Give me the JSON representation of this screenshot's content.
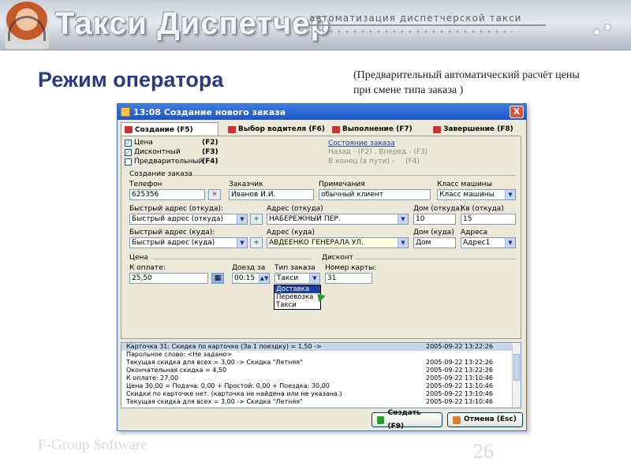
{
  "header": {
    "app_name": "Такси Диспетчер",
    "tagline": "автоматизация диспетчерской такси"
  },
  "slide": {
    "title": "Режим оператора",
    "subtitle": "(Предварительный автоматический расчёт цены при смене типа заказа )",
    "footer_brand": "F-Group Software",
    "page_number": "26"
  },
  "window": {
    "title": "13:08 Создание нового заказа",
    "close_label": "X",
    "tabs": [
      {
        "label": "Создание (F5)"
      },
      {
        "label": "Выбор водителя (F6)"
      },
      {
        "label": "Выполнение (F7)"
      },
      {
        "label": "Завершение (F8)"
      }
    ],
    "options": [
      {
        "label": "Цена",
        "hotkey": "(F2)",
        "checked": true
      },
      {
        "label": "Дисконтный",
        "hotkey": "(F3)",
        "checked": true
      },
      {
        "label": "Предварительный",
        "hotkey": "(F4)",
        "checked": false
      }
    ],
    "status": {
      "link": "Состояние заказа",
      "back": "Назад - (F2) . Вперед - (F3)",
      "end": "В конец (в пути) -",
      "end_key": "(F4)"
    },
    "section_order": "Создание заказа",
    "phone": {
      "label": "Телефон",
      "value": "625356"
    },
    "customer": {
      "label": "Заказчик",
      "value": "Иванов И.И."
    },
    "notes": {
      "label": "Примечания",
      "value": "обычный клиент"
    },
    "car_class": {
      "label": "Класс машины",
      "value": "Класс машины"
    },
    "quick_from": {
      "label": "Быстрый адрес (откуда):",
      "value": "Быстрый адрес (откуда)"
    },
    "addr_from": {
      "label": "Адрес (откуда)",
      "value": "НАБЕРЕЖНЫЙ ПЕР."
    },
    "house_from": {
      "label": "Дом (откуда)",
      "value": "10"
    },
    "apt_from": {
      "label": "Кв (откуда)",
      "value": "15"
    },
    "quick_to": {
      "label": "Быстрый адрес (куда):",
      "value": "Быстрый адрес (куда)"
    },
    "addr_to": {
      "label": "Адрес (куда)",
      "value": "АВДЕЕНКО ГЕНЕРАЛА УЛ."
    },
    "house_to": {
      "label": "Дом (куда)",
      "value": "Дом"
    },
    "address_sel": {
      "label": "Адреса",
      "value": "Адрес1"
    },
    "section_price": "Цена",
    "section_discount": "Дисконт",
    "to_pay": {
      "label": "К оплате:",
      "value": "25,50"
    },
    "arrival": {
      "label": "Доезд за",
      "value": "00:15"
    },
    "order_type": {
      "label": "Тип заказа",
      "value": "Такси"
    },
    "card": {
      "label": "Номер карты:",
      "value": "31"
    },
    "dropdown_options": [
      "Доставка",
      "Перевозка",
      "Такси"
    ],
    "log": [
      {
        "msg": "Карточка 31: Скидка по карточке (За 1 поездку) = 1,50 ->",
        "ts": "2005-09-22 13:22:26"
      },
      {
        "msg": "Парольное слово: <Не задано>",
        "ts": ""
      },
      {
        "msg": "Текущая скидка для всех = 3,00 -> Скидка \"Летняя\"",
        "ts": "2005-09-22 13:22:26"
      },
      {
        "msg": "Окончательная скидка = 4,50",
        "ts": "2005-09-22 13:22:26"
      },
      {
        "msg": "К оплате: 27,00",
        "ts": "2005-09-22 13:10:46"
      },
      {
        "msg": "Цена 30,00 = Подача: 0,00 + Простой: 0,00 + Поездка: 30,00",
        "ts": "2005-09-22 13:10:46"
      },
      {
        "msg": "Скидки по карточке нет. (карточка не найдена или не указана.)",
        "ts": "2005-09-22 13:10:46"
      },
      {
        "msg": "Текущая скидка для всех = 3,00 -> Скидка \"Летняя\"",
        "ts": "2005-09-22 13:10:46"
      }
    ],
    "create_button": "Создать (F9)",
    "cancel_button": "Отмена (Esc)"
  }
}
